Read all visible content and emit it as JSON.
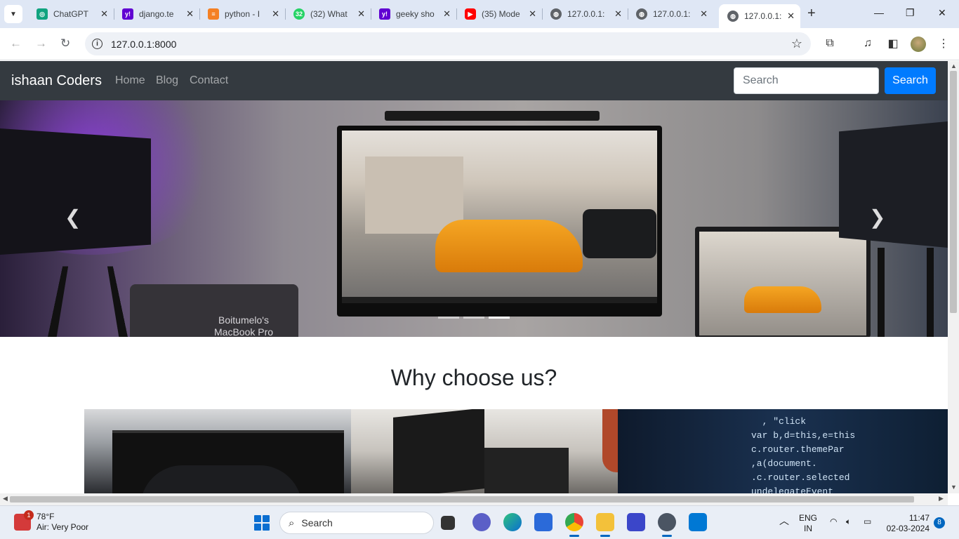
{
  "browser": {
    "tabs": [
      {
        "title": "ChatGPT",
        "favicon": "chatgpt-icon",
        "color": "#10a37f"
      },
      {
        "title": "django.te",
        "favicon": "yahoo-icon",
        "color": "#6001d2"
      },
      {
        "title": "python - I",
        "favicon": "stackoverflow-icon",
        "color": "#f48024"
      },
      {
        "title": "(32) What",
        "favicon": "whatsapp-icon",
        "color": "#25d366",
        "badge": "32"
      },
      {
        "title": "geeky sho",
        "favicon": "yahoo-icon",
        "color": "#6001d2"
      },
      {
        "title": "(35) Mode",
        "favicon": "youtube-icon",
        "color": "#ff0000"
      },
      {
        "title": "127.0.0.1:",
        "favicon": "globe-icon",
        "color": "#5f6368"
      },
      {
        "title": "127.0.0.1:",
        "favicon": "globe-icon",
        "color": "#5f6368"
      },
      {
        "title": "127.0.0.1:",
        "favicon": "globe-icon",
        "color": "#5f6368",
        "active": true
      }
    ],
    "url": "127.0.0.1:8000"
  },
  "site": {
    "brand": "ishaan Coders",
    "nav": [
      "Home",
      "Blog",
      "Contact"
    ],
    "search_placeholder": "Search",
    "search_button": "Search",
    "carousel": {
      "laptop_label_line1": "Boitumelo's",
      "laptop_label_line2": "MacBook Pro",
      "active_slide": 3,
      "slide_count": 3
    },
    "section_heading": "Why choose us?",
    "code_lines": [
      "  , \"click",
      "var b,d=this,e=this",
      "c.router.themePar",
      ",a(document.",
      ".c.router.selected",
      "undelegateEvent"
    ]
  },
  "taskbar": {
    "weather_temp": "78°F",
    "weather_desc": "Air: Very Poor",
    "weather_badge": "1",
    "search_label": "Search",
    "lang_line1": "ENG",
    "lang_line2": "IN",
    "time": "11:47",
    "date": "02-03-2024",
    "notifications": "8"
  }
}
